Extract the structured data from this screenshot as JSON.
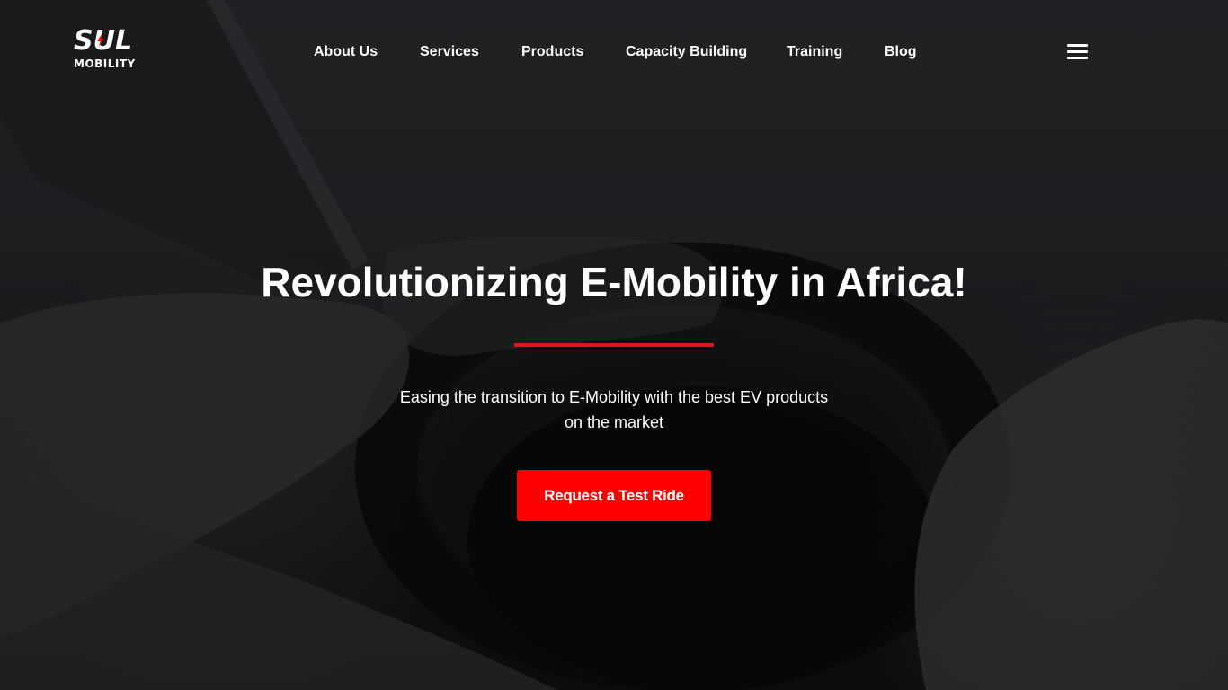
{
  "brand": {
    "logo_top": "SUL",
    "logo_bottom": "MOBILITY",
    "accent_color": "#ff0000"
  },
  "nav": {
    "items": [
      {
        "label": "About Us"
      },
      {
        "label": "Services"
      },
      {
        "label": "Products"
      },
      {
        "label": "Capacity Building"
      },
      {
        "label": "Training"
      },
      {
        "label": "Blog"
      }
    ],
    "menu_icon": "hamburger-menu-icon"
  },
  "hero": {
    "headline": "Revolutionizing E-Mobility in Africa!",
    "subtitle_line1": "Easing the transition to E-Mobility with the best EV products",
    "subtitle_line2": "on the market",
    "cta_label": "Request a Test Ride",
    "background": "dark-photo-hands-on-steering-wheel"
  }
}
